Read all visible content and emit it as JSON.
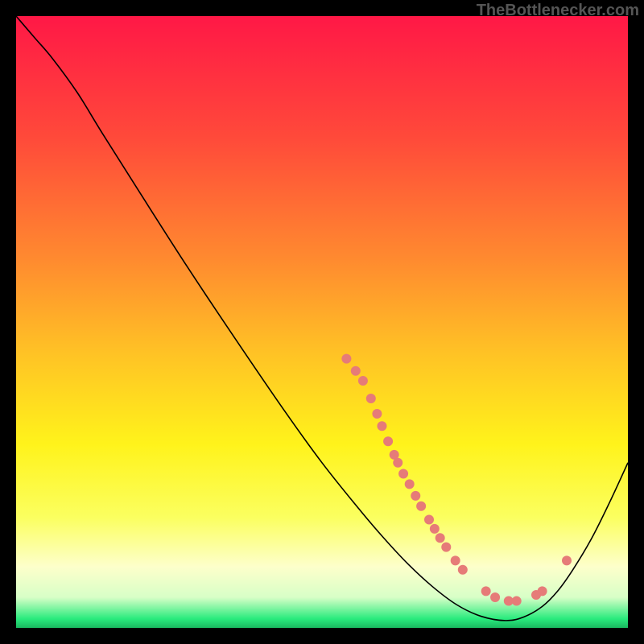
{
  "watermark": "TheBottlenecker.com",
  "chart_data": {
    "type": "line",
    "title": "",
    "xlabel": "",
    "ylabel": "",
    "xlim": [
      0,
      100
    ],
    "ylim": [
      0,
      100
    ],
    "background_gradient": {
      "stops": [
        {
          "offset": 0.0,
          "color": "#ff1846"
        },
        {
          "offset": 0.2,
          "color": "#ff4a3a"
        },
        {
          "offset": 0.4,
          "color": "#ff8b2f"
        },
        {
          "offset": 0.55,
          "color": "#ffc225"
        },
        {
          "offset": 0.7,
          "color": "#fff31b"
        },
        {
          "offset": 0.82,
          "color": "#fbff60"
        },
        {
          "offset": 0.9,
          "color": "#fdffcb"
        },
        {
          "offset": 0.95,
          "color": "#d8ffc7"
        },
        {
          "offset": 0.985,
          "color": "#29eb7d"
        },
        {
          "offset": 1.0,
          "color": "#1ab85f"
        }
      ]
    },
    "series": [
      {
        "name": "bottleneck-curve",
        "type": "curve",
        "color": "#000000",
        "width": 1.6,
        "points": [
          {
            "x": 0.0,
            "y": 100.0
          },
          {
            "x": 3.0,
            "y": 96.5
          },
          {
            "x": 6.0,
            "y": 93.0
          },
          {
            "x": 10.0,
            "y": 87.5
          },
          {
            "x": 14.0,
            "y": 81.0
          },
          {
            "x": 20.0,
            "y": 71.5
          },
          {
            "x": 28.0,
            "y": 59.0
          },
          {
            "x": 36.0,
            "y": 47.0
          },
          {
            "x": 44.0,
            "y": 35.3
          },
          {
            "x": 50.0,
            "y": 27.0
          },
          {
            "x": 56.0,
            "y": 19.5
          },
          {
            "x": 60.0,
            "y": 14.8
          },
          {
            "x": 64.0,
            "y": 10.5
          },
          {
            "x": 68.0,
            "y": 6.8
          },
          {
            "x": 72.0,
            "y": 3.8
          },
          {
            "x": 76.0,
            "y": 1.9
          },
          {
            "x": 80.0,
            "y": 1.2
          },
          {
            "x": 83.0,
            "y": 1.8
          },
          {
            "x": 86.0,
            "y": 3.5
          },
          {
            "x": 88.5,
            "y": 6.0
          },
          {
            "x": 91.0,
            "y": 9.5
          },
          {
            "x": 94.0,
            "y": 14.5
          },
          {
            "x": 97.0,
            "y": 20.5
          },
          {
            "x": 100.0,
            "y": 27.0
          }
        ]
      },
      {
        "name": "data-points",
        "type": "scatter",
        "color": "#e67b78",
        "radius": 6,
        "points": [
          {
            "x": 54.0,
            "y": 44.0
          },
          {
            "x": 55.5,
            "y": 42.0
          },
          {
            "x": 56.7,
            "y": 40.4
          },
          {
            "x": 58.0,
            "y": 37.5
          },
          {
            "x": 59.0,
            "y": 35.0
          },
          {
            "x": 59.8,
            "y": 33.0
          },
          {
            "x": 60.8,
            "y": 30.5
          },
          {
            "x": 61.8,
            "y": 28.3
          },
          {
            "x": 62.4,
            "y": 27.0
          },
          {
            "x": 63.3,
            "y": 25.2
          },
          {
            "x": 64.3,
            "y": 23.5
          },
          {
            "x": 65.3,
            "y": 21.6
          },
          {
            "x": 66.2,
            "y": 19.9
          },
          {
            "x": 67.5,
            "y": 17.7
          },
          {
            "x": 68.4,
            "y": 16.2
          },
          {
            "x": 69.3,
            "y": 14.7
          },
          {
            "x": 70.3,
            "y": 13.2
          },
          {
            "x": 71.8,
            "y": 11.0
          },
          {
            "x": 73.0,
            "y": 9.5
          },
          {
            "x": 76.8,
            "y": 6.0
          },
          {
            "x": 78.3,
            "y": 5.0
          },
          {
            "x": 80.5,
            "y": 4.4
          },
          {
            "x": 81.8,
            "y": 4.4
          },
          {
            "x": 85.0,
            "y": 5.4
          },
          {
            "x": 86.0,
            "y": 6.0
          },
          {
            "x": 90.0,
            "y": 11.0
          }
        ]
      }
    ]
  }
}
